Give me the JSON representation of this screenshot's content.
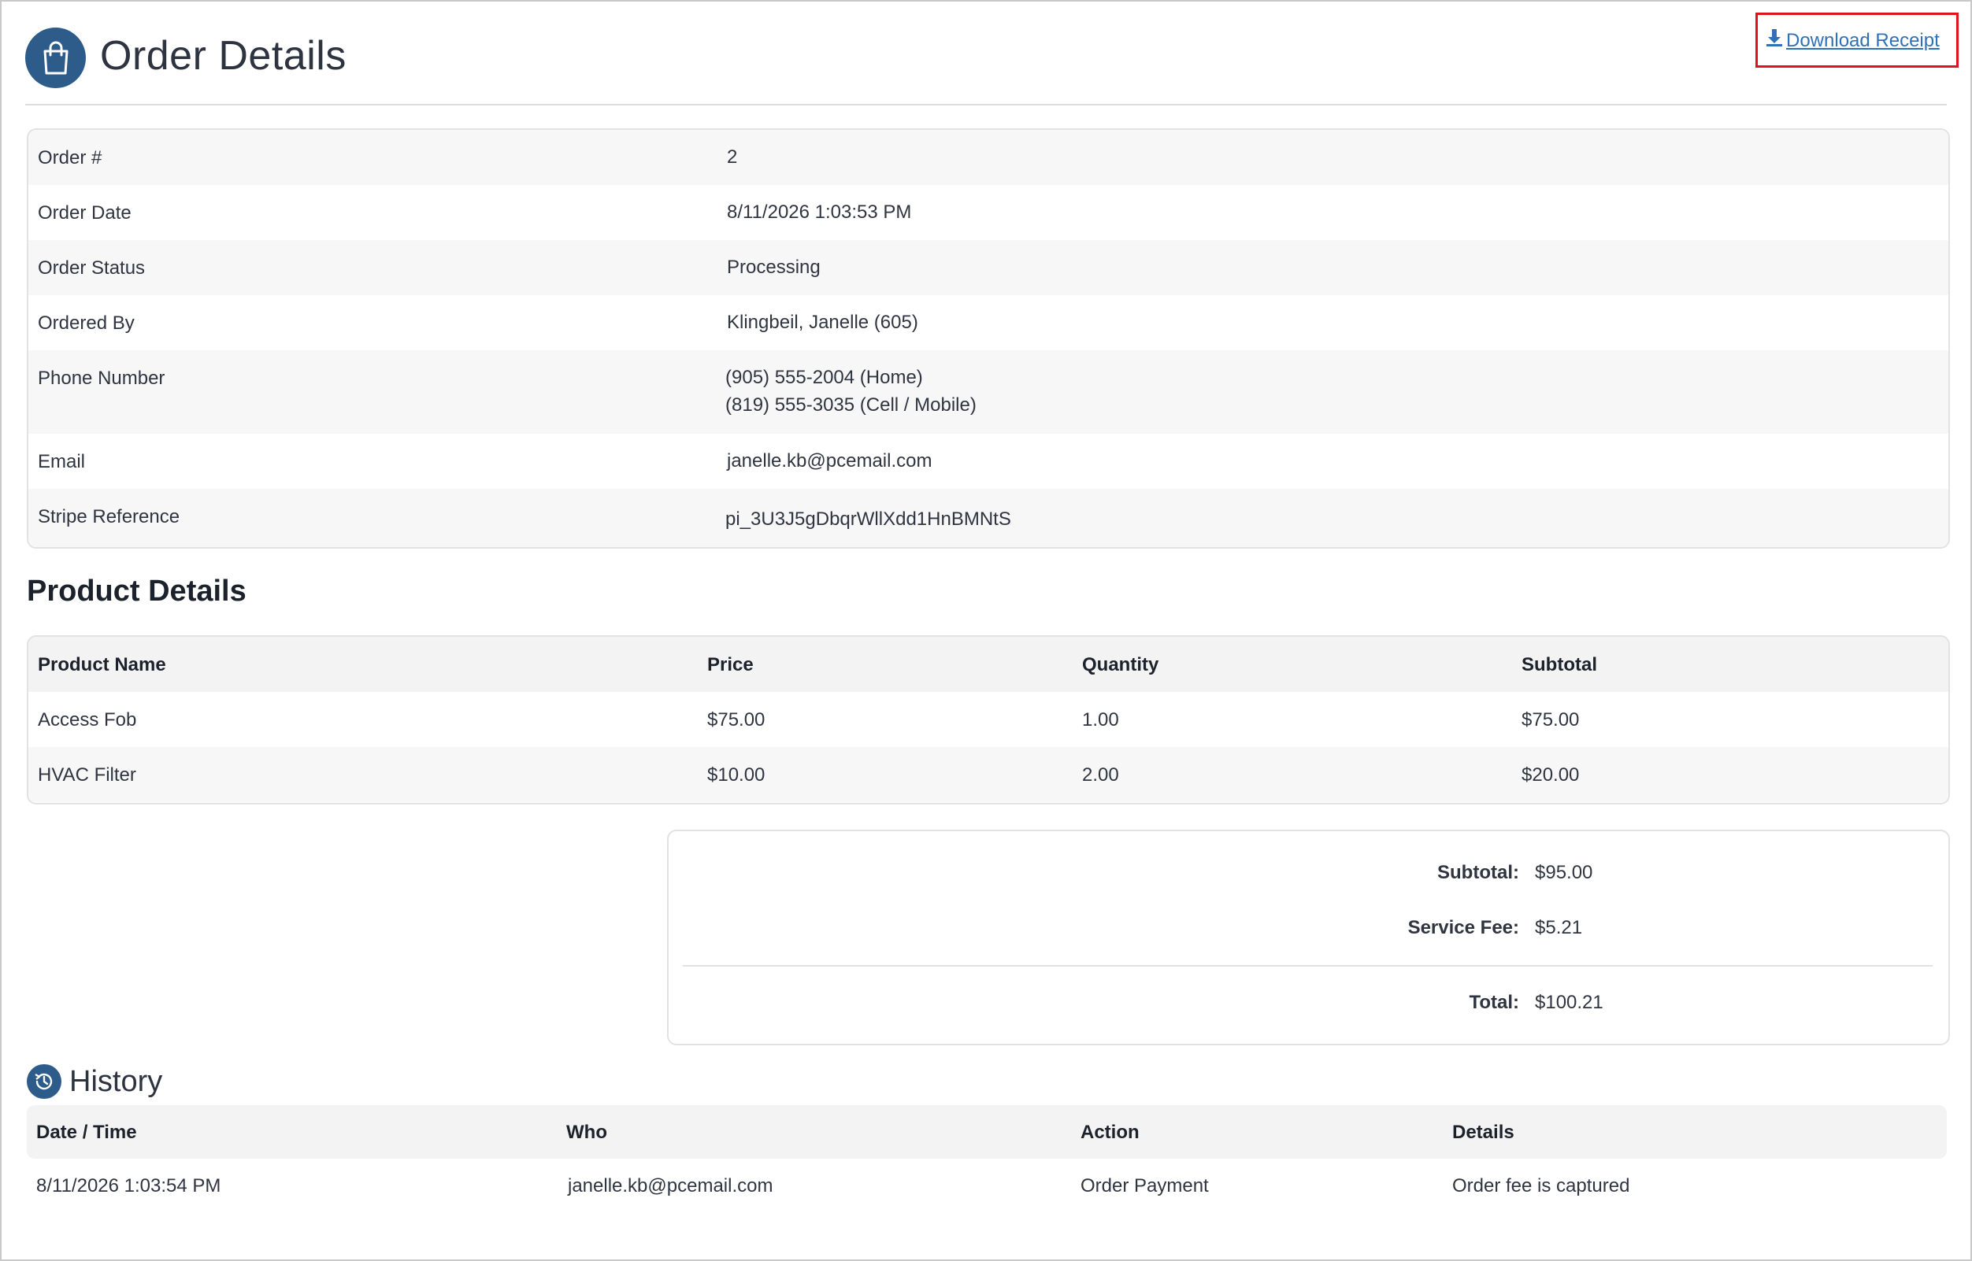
{
  "header": {
    "title": "Order Details",
    "download_label": "Download Receipt"
  },
  "order_info": {
    "order_number_label": "Order #",
    "order_number": "2",
    "order_date_label": "Order Date",
    "order_date": "8/11/2026 1:03:53 PM",
    "order_status_label": "Order Status",
    "order_status": "Processing",
    "ordered_by_label": "Ordered By",
    "ordered_by": "Klingbeil, Janelle (605)",
    "phone_label": "Phone Number",
    "phone_home": "(905) 555-2004 (Home)",
    "phone_mobile": "(819) 555-3035 (Cell / Mobile)",
    "email_label": "Email",
    "email": "janelle.kb@pcemail.com",
    "stripe_label": "Stripe Reference",
    "stripe_ref": "pi_3U3J5gDbqrWllXdd1HnBMNtS"
  },
  "products": {
    "title": "Product Details",
    "columns": [
      "Product Name",
      "Price",
      "Quantity",
      "Subtotal"
    ],
    "rows": [
      [
        "Access Fob",
        "$75.00",
        "1.00",
        "$75.00"
      ],
      [
        "HVAC Filter",
        "$10.00",
        "2.00",
        "$20.00"
      ]
    ]
  },
  "totals": {
    "subtotal_label": "Subtotal:",
    "subtotal": "$95.00",
    "service_fee_label": "Service Fee:",
    "service_fee": "$5.21",
    "total_label": "Total:",
    "total": "$100.21"
  },
  "history": {
    "title": "History",
    "columns": [
      "Date / Time",
      "Who",
      "Action",
      "Details"
    ],
    "rows": [
      [
        "8/11/2026 1:03:54 PM",
        "janelle.kb@pcemail.com",
        "Order Payment",
        "Order fee is captured"
      ]
    ]
  },
  "icons": {
    "title_icon": "shopping-bag-icon",
    "download_icon": "download-icon",
    "history_icon": "history-clock-icon"
  },
  "colors": {
    "brand": "#2d5b8a",
    "link": "#2f71b4",
    "highlight_border": "#e0121b"
  }
}
